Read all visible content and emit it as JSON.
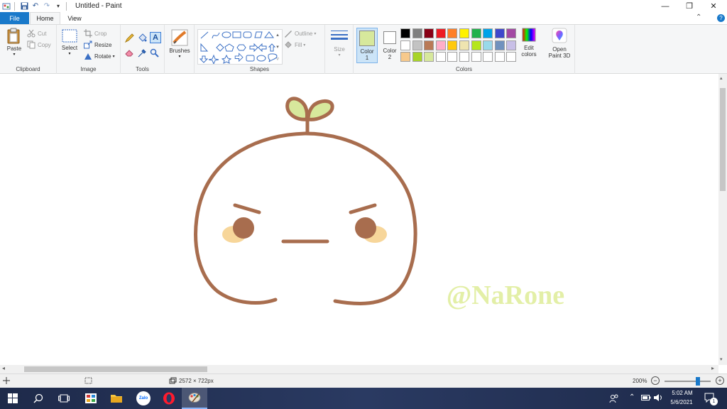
{
  "window": {
    "title": "Untitled - Paint",
    "qa_undo": "↶",
    "qa_redo": "↷",
    "qa_dropdown": "▾",
    "minimize": "—",
    "maximize": "❐",
    "close": "✕",
    "collapse_ribbon": "⌃",
    "help": "?"
  },
  "tabs": {
    "file": "File",
    "home": "Home",
    "view": "View"
  },
  "ribbon": {
    "clipboard": {
      "label": "Clipboard",
      "paste": "Paste",
      "cut": "Cut",
      "copy": "Copy"
    },
    "image": {
      "label": "Image",
      "select": "Select",
      "crop": "Crop",
      "resize": "Resize",
      "rotate": "Rotate"
    },
    "tools": {
      "label": "Tools"
    },
    "brushes": {
      "label": "Brushes"
    },
    "shapes": {
      "label": "Shapes",
      "outline": "Outline",
      "fill": "Fill"
    },
    "size": {
      "label": "Size"
    },
    "colors": {
      "label": "Colors",
      "color1": "Color",
      "color1_num": "1",
      "color2": "Color",
      "color2_num": "2",
      "color1_value": "#d7e89c",
      "color2_value": "#ffffff",
      "edit_colors_line1": "Edit",
      "edit_colors_line2": "colors",
      "palette_row1": [
        "#000000",
        "#7f7f7f",
        "#880015",
        "#ed1c24",
        "#ff7f27",
        "#fff200",
        "#22b14c",
        "#00a2e8",
        "#3f48cc",
        "#a349a4"
      ],
      "palette_row2": [
        "#ffffff",
        "#c3c3c3",
        "#b97a57",
        "#ffaec9",
        "#ffc90e",
        "#efe4b0",
        "#b5e61d",
        "#99d9ea",
        "#7092be",
        "#c8bfe7"
      ],
      "palette_row3": [
        "#f7c98c",
        "#a8d42a",
        "#d7e89c",
        "#ffffff",
        "#ffffff",
        "#ffffff",
        "#ffffff",
        "#ffffff",
        "#ffffff",
        "#ffffff"
      ]
    },
    "paint3d": {
      "line1": "Open",
      "line2": "Paint 3D"
    }
  },
  "canvas": {
    "watermark": "@NaRone",
    "outline_color": "#a86d4e",
    "leaf_color": "#d7e89c",
    "blush_color": "#f7d69a",
    "watermark_color": "#e3efa7"
  },
  "status": {
    "dimensions": "2572 × 722px",
    "zoom": "200%",
    "zoom_level": 0.75
  },
  "taskbar": {
    "zalo": "Zalo",
    "time": "5:02 AM",
    "date": "5/6/2021",
    "notifications": "1"
  }
}
